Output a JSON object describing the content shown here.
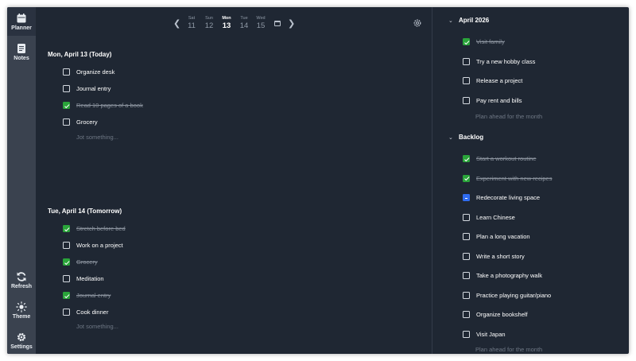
{
  "sidebar": {
    "planner": "Planner",
    "notes": "Notes",
    "refresh": "Refresh",
    "theme": "Theme",
    "settings": "Settings"
  },
  "datenav": {
    "days": [
      {
        "name": "Sat",
        "num": "11"
      },
      {
        "name": "Sun",
        "num": "12"
      },
      {
        "name": "Mon",
        "num": "13"
      },
      {
        "name": "Tue",
        "num": "14"
      },
      {
        "name": "Wed",
        "num": "15"
      }
    ]
  },
  "today": {
    "title": "Mon, April 13 (Today)",
    "tasks": [
      {
        "label": "Organize desk",
        "done": false
      },
      {
        "label": "Journal entry",
        "done": false
      },
      {
        "label": "Read 10 pages of a book",
        "done": true
      },
      {
        "label": "Grocery",
        "done": false
      }
    ],
    "placeholder": "Jot something..."
  },
  "tomorrow": {
    "title": "Tue, April 14 (Tomorrow)",
    "tasks": [
      {
        "label": "Stretch before bed",
        "done": true
      },
      {
        "label": "Work on a project",
        "done": false
      },
      {
        "label": "Grocery",
        "done": true
      },
      {
        "label": "Meditation",
        "done": false
      },
      {
        "label": "Journal entry",
        "done": true
      },
      {
        "label": "Cook dinner",
        "done": false
      }
    ],
    "placeholder": "Jot something..."
  },
  "month": {
    "title": "April 2026",
    "tasks": [
      {
        "label": "Visit family",
        "done": true
      },
      {
        "label": "Try a new hobby class",
        "done": false
      },
      {
        "label": "Release a project",
        "done": false
      },
      {
        "label": "Pay rent and bills",
        "done": false
      }
    ],
    "placeholder": "Plan ahead for the month"
  },
  "backlog": {
    "title": "Backlog",
    "tasks": [
      {
        "label": "Start a workout routine",
        "done": true
      },
      {
        "label": "Experiment with new recipes",
        "done": true
      },
      {
        "label": "Redecorate living space",
        "done": false,
        "partial": true
      },
      {
        "label": "Learn Chinese",
        "done": false
      },
      {
        "label": "Plan a long vacation",
        "done": false
      },
      {
        "label": "Write a short story",
        "done": false
      },
      {
        "label": "Take a photography walk",
        "done": false
      },
      {
        "label": "Practice playing guitar/piano",
        "done": false
      },
      {
        "label": "Organize bookshelf",
        "done": false
      },
      {
        "label": "Visit Japan",
        "done": false
      }
    ],
    "placeholder": "Plan ahead for the month"
  },
  "colors": {
    "background": "#1f2733",
    "sidebar": "#3a424f",
    "checked": "#2aa43a",
    "partial": "#2f6cf0"
  }
}
